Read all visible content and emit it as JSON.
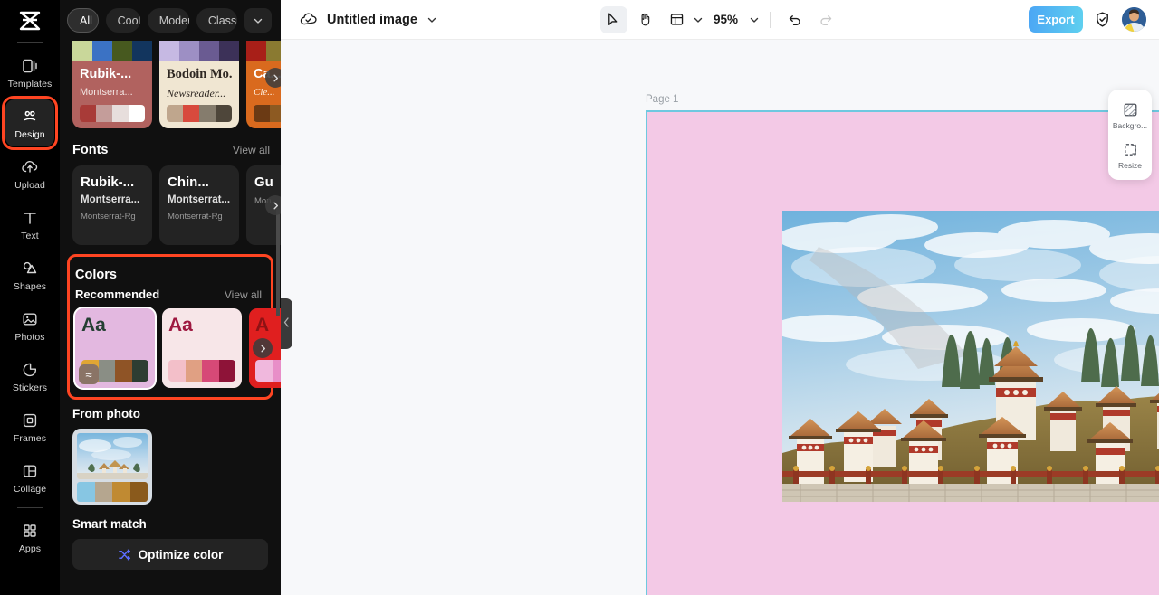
{
  "app": {
    "logo": "capcut-logo"
  },
  "rail": {
    "items": [
      {
        "label": "Templates",
        "icon": "templates-icon",
        "active": false
      },
      {
        "label": "Design",
        "icon": "design-icon",
        "active": true,
        "highlighted": true
      },
      {
        "label": "Upload",
        "icon": "upload-icon",
        "active": false
      },
      {
        "label": "Text",
        "icon": "text-icon",
        "active": false
      },
      {
        "label": "Shapes",
        "icon": "shapes-icon",
        "active": false
      },
      {
        "label": "Photos",
        "icon": "photos-icon",
        "active": false
      },
      {
        "label": "Stickers",
        "icon": "stickers-icon",
        "active": false
      },
      {
        "label": "Frames",
        "icon": "frames-icon",
        "active": false
      },
      {
        "label": "Collage",
        "icon": "collage-icon",
        "active": false
      },
      {
        "label": "Apps",
        "icon": "apps-icon",
        "active": false
      }
    ]
  },
  "panel": {
    "filters": [
      {
        "label": "All",
        "selected": true
      },
      {
        "label": "Cool",
        "selected": false
      },
      {
        "label": "Modern",
        "selected": false
      },
      {
        "label": "Classic",
        "selected": false
      }
    ],
    "filters_more_icon": "chevron-down-icon",
    "template_cards": [
      {
        "title": "Rubik-...",
        "subtitle": "Montserra...",
        "bg": "#b1625f",
        "title_color": "#ffffff",
        "subtitle_color": "#f3e6e4",
        "swatches": [
          "#a83b38",
          "#c49d9a",
          "#e7dedc",
          "#ffffff"
        ],
        "prev_swatches": [
          "#c9d79a",
          "#3b72c4",
          "#47591f",
          "#12355e"
        ],
        "prev_bg": "#a9c6e8"
      },
      {
        "title": "Bodoin Mo...",
        "subtitle": "Newsreader...",
        "bg": "#f0e6d2",
        "title_color": "#2e2722",
        "subtitle_color": "#2e2722",
        "swatches": [
          "#bfa68d",
          "#d84a3d",
          "#857c6d",
          "#4e463a"
        ],
        "prev_swatches": [
          "#c6b9e3",
          "#9d8fc4",
          "#6a5b92",
          "#3c3158"
        ],
        "prev_bg": "#ece7f7"
      },
      {
        "title": "Ca...",
        "subtitle": "Cle...",
        "bg": "#d96a1e",
        "title_color": "#ffffff",
        "subtitle_color": "#ffeedd",
        "swatches": [
          "#6b3a14",
          "#8d5a22",
          "#a5743a",
          "#c28c4c"
        ],
        "prev_swatches": [
          "#a81f18",
          "#8a7a31",
          "#6f6520",
          "#3c3714"
        ],
        "prev_bg": "#c6321f"
      }
    ],
    "fonts_section": {
      "title": "Fonts",
      "view_all": "View all"
    },
    "font_cards": [
      {
        "line1": "Rubik-...",
        "line2": "Montserra...",
        "line3": "Montserrat-Rg"
      },
      {
        "line1": "Chin...",
        "line2": "Montserrat...",
        "line3": "Montserrat-Rg"
      },
      {
        "line1": "Gu",
        "line2": "",
        "line3": "Mon"
      }
    ],
    "colors_section": {
      "title": "Colors",
      "sub": "Recommended",
      "view_all": "View all"
    },
    "color_cards": [
      {
        "aa": "Aa",
        "bg": "#e3b8e0",
        "aa_color": "#243f33",
        "swatches": [
          "#e0a634",
          "#8a8e85",
          "#8f5426",
          "#2d3d32"
        ],
        "badge": "wave-icon",
        "selected": true
      },
      {
        "aa": "Aa",
        "bg": "#f7e6e8",
        "aa_color": "#9e1840",
        "swatches": [
          "#f3bfc9",
          "#e0a083",
          "#d64977",
          "#8e1338"
        ],
        "badge": null,
        "selected": false
      },
      {
        "aa": "A",
        "bg": "#e01f1f",
        "aa_color": "#8e1214",
        "swatches": [
          "#f0b8dd",
          "#e88ec8",
          "#d45fae",
          "#a82f7e"
        ],
        "badge": null,
        "selected": false
      }
    ],
    "from_photo_label": "From photo",
    "from_photo_swatches": [
      "#87c6e3",
      "#b5a68f",
      "#c08a32",
      "#8a5a1c"
    ],
    "smart_match_label": "Smart match",
    "optimize_button": {
      "label": "Optimize color",
      "icon": "shuffle-icon"
    },
    "next_arrow_icon": "chevron-right-icon",
    "collapse_icon": "chevron-left-icon"
  },
  "topbar": {
    "cloud_icon": "cloud-check-icon",
    "doc_title": "Untitled image",
    "doc_caret_icon": "chevron-down-icon",
    "tools": [
      {
        "name": "select-tool",
        "icon": "cursor-icon",
        "active": true
      },
      {
        "name": "hand-tool",
        "icon": "hand-icon",
        "active": false
      },
      {
        "name": "layout-tool",
        "icon": "layout-icon",
        "active": false
      }
    ],
    "zoom_value": "95%",
    "zoom_caret_icon": "chevron-down-icon",
    "undo_icon": "undo-icon",
    "redo_icon": "redo-icon",
    "export_label": "Export",
    "shield_icon": "shield-check-icon",
    "avatar": "user-avatar"
  },
  "canvas": {
    "page_label": "Page 1",
    "page_bg": "#f3c9e6",
    "selection_color": "#6ec8e0",
    "photo_alt": "bhutan-chortens-photo"
  },
  "right_dock": {
    "items": [
      {
        "label": "Backgro...",
        "icon": "background-icon"
      },
      {
        "label": "Resize",
        "icon": "resize-icon"
      }
    ]
  }
}
